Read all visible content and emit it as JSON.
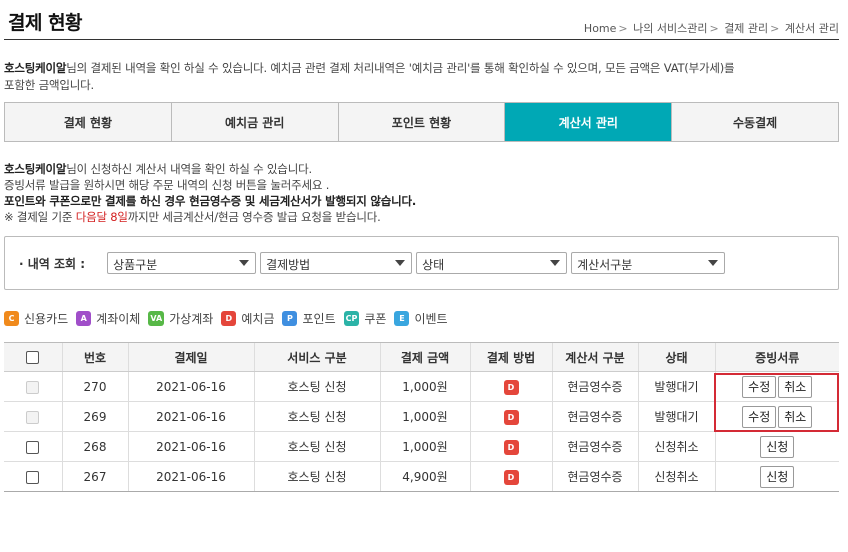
{
  "page": {
    "title": "결제 현황",
    "breadcrumb": [
      "Home",
      "나의 서비스관리",
      "결제 관리",
      "계산서 관리"
    ]
  },
  "intro": {
    "brand": "호스팅케이알",
    "line1_rest": "님의 결제된 내역을 확인 하실 수 있습니다. 예치금 관련 결제 처리내역은 '예치금 관리'를 통해 확인하실 수 있으며, 모든 금액은 VAT(부가세)를",
    "line2": "포함한 금액입니다."
  },
  "tabs": [
    {
      "label": "결제 현황",
      "active": false
    },
    {
      "label": "예치금 관리",
      "active": false
    },
    {
      "label": "포인트 현황",
      "active": false
    },
    {
      "label": "계산서 관리",
      "active": true
    },
    {
      "label": "수동결제",
      "active": false
    }
  ],
  "notice": {
    "brand": "호스팅케이알",
    "line1_rest": "님이 신청하신 계산서 내역을 확인 하실 수 있습니다.",
    "line2": "증빙서류 발급을 원하시면 해당 주문 내역의 신청 버튼을 눌러주세요 .",
    "line3": "포인트와 쿠폰으로만 결제를 하신 경우 현금영수증 및 세금계산서가 발행되지 않습니다.",
    "line4_prefix": "※ 결제일 기준 ",
    "line4_red": "다음달 8일",
    "line4_suffix": "까지만 세금계산서/현금 영수증 발급 요청을 받습니다."
  },
  "filter": {
    "label": "· 내역 조회 :",
    "selects": [
      "상품구분",
      "결제방법",
      "상태",
      "계산서구분"
    ]
  },
  "legend": [
    {
      "code": "C",
      "label": "신용카드",
      "color": "#f08a1c"
    },
    {
      "code": "A",
      "label": "계좌이체",
      "color": "#a04ec9"
    },
    {
      "code": "VA",
      "label": "가상계좌",
      "color": "#57b847"
    },
    {
      "code": "D",
      "label": "예치금",
      "color": "#e4463b"
    },
    {
      "code": "P",
      "label": "포인트",
      "color": "#3f8fe0"
    },
    {
      "code": "CP",
      "label": "쿠폰",
      "color": "#2bb3a7"
    },
    {
      "code": "E",
      "label": "이벤트",
      "color": "#39a6df"
    }
  ],
  "table": {
    "headers": [
      "",
      "번호",
      "결제일",
      "서비스 구분",
      "결제 금액",
      "결제 방법",
      "계산서 구분",
      "상태",
      "증빙서류"
    ],
    "rows": [
      {
        "no": "270",
        "date": "2021-06-16",
        "service": "호스팅 신청",
        "amount": "1,000원",
        "method": "D",
        "invoice": "현금영수증",
        "status": "발행대기",
        "checkbox_disabled": true,
        "actions": [
          "수정",
          "취소"
        ]
      },
      {
        "no": "269",
        "date": "2021-06-16",
        "service": "호스팅 신청",
        "amount": "1,000원",
        "method": "D",
        "invoice": "현금영수증",
        "status": "발행대기",
        "checkbox_disabled": true,
        "actions": [
          "수정",
          "취소"
        ]
      },
      {
        "no": "268",
        "date": "2021-06-16",
        "service": "호스팅 신청",
        "amount": "1,000원",
        "method": "D",
        "invoice": "현금영수증",
        "status": "신청취소",
        "checkbox_disabled": false,
        "actions": [
          "신청"
        ]
      },
      {
        "no": "267",
        "date": "2021-06-16",
        "service": "호스팅 신청",
        "amount": "4,900원",
        "method": "D",
        "invoice": "현금영수증",
        "status": "신청취소",
        "checkbox_disabled": false,
        "actions": [
          "신청"
        ]
      }
    ]
  },
  "colors": {
    "accent": "#00a8b5",
    "highlight": "#d42a35",
    "notice_red": "#d31f1f"
  }
}
